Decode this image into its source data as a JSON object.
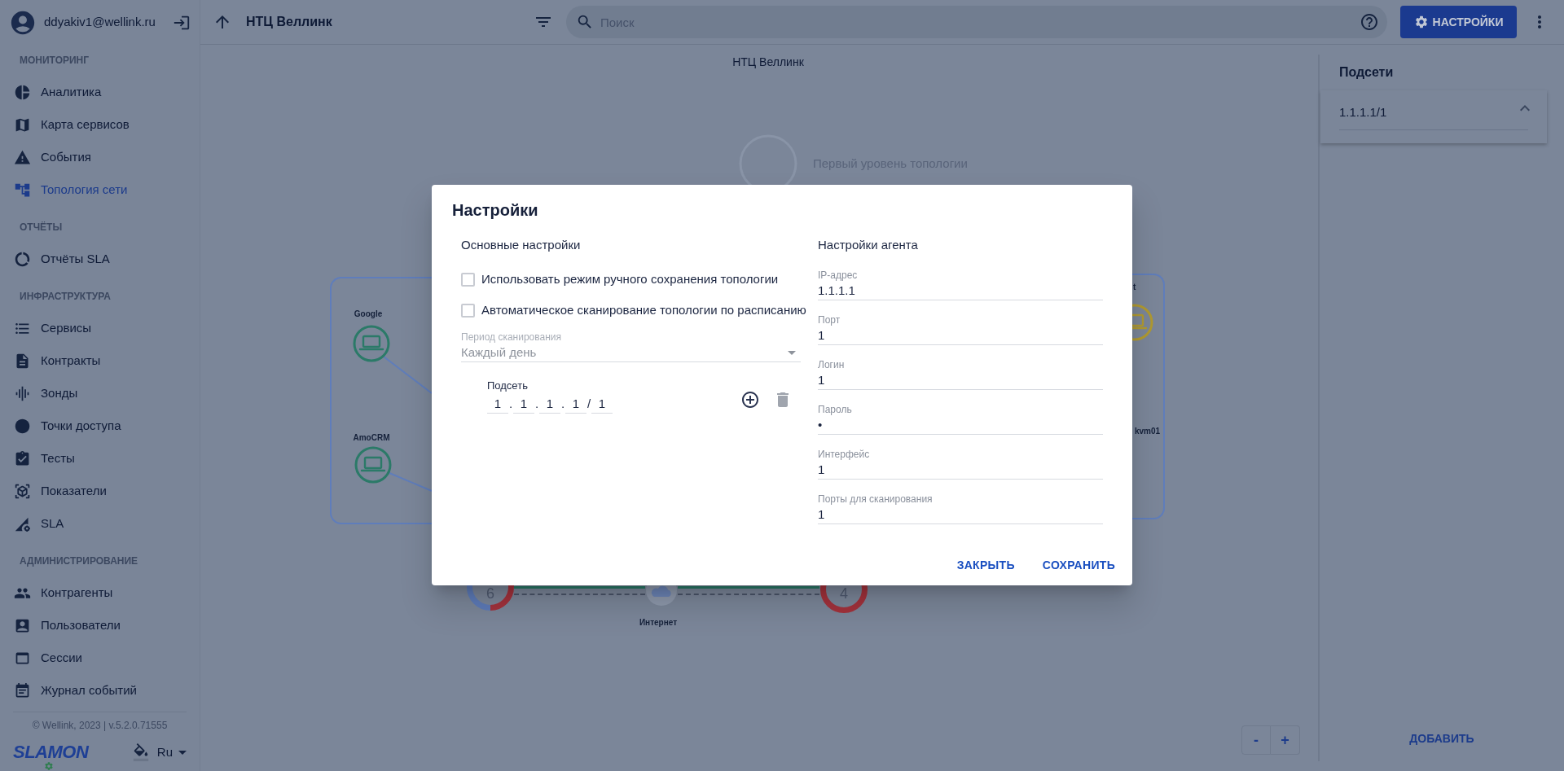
{
  "user": {
    "email": "ddyakiv1@wellink.ru"
  },
  "sidebar": {
    "sections": [
      {
        "title": "МОНИТОРИНГ",
        "items": [
          {
            "label": "Аналитика",
            "selected": false
          },
          {
            "label": "Карта сервисов",
            "selected": false
          },
          {
            "label": "События",
            "selected": false
          },
          {
            "label": "Топология сети",
            "selected": true
          }
        ]
      },
      {
        "title": "ОТЧЁТЫ",
        "items": [
          {
            "label": "Отчёты SLA",
            "selected": false
          }
        ]
      },
      {
        "title": "ИНФРАСТРУКТУРА",
        "items": [
          {
            "label": "Сервисы",
            "selected": false
          },
          {
            "label": "Контракты",
            "selected": false
          },
          {
            "label": "Зонды",
            "selected": false
          },
          {
            "label": "Точки доступа",
            "selected": false
          },
          {
            "label": "Тесты",
            "selected": false
          },
          {
            "label": "Показатели",
            "selected": false
          },
          {
            "label": "SLA",
            "selected": false
          }
        ]
      },
      {
        "title": "АДМИНИСТРИРОВАНИЕ",
        "items": [
          {
            "label": "Контрагенты",
            "selected": false
          },
          {
            "label": "Пользователи",
            "selected": false
          },
          {
            "label": "Сессии",
            "selected": false
          },
          {
            "label": "Журнал событий",
            "selected": false
          }
        ]
      }
    ],
    "footer": {
      "copyright": "© Wellink, 2023 | v.5.2.0.71555",
      "logo": "SLAMON",
      "language": "Ru"
    }
  },
  "toolbar": {
    "title": "НТЦ Веллинк",
    "search": {
      "placeholder": "Поиск"
    },
    "settings_button": "НАСТРОЙКИ"
  },
  "topology": {
    "title": "НТЦ Веллинк",
    "level_label": "Первый уровень топологии",
    "hosts": [
      {
        "label": "Google",
        "color": "#2b7a68"
      },
      {
        "label": "AmoCRM",
        "color": "#2b7a68"
      },
      {
        "label": "t",
        "color": "#b09a31"
      },
      {
        "label": "kvm01"
      }
    ],
    "counters": [
      {
        "value": "6",
        "segments": [
          {
            "color": "#5d7bb8"
          },
          {
            "color": "#a3323c"
          }
        ]
      },
      {
        "value": "4",
        "segments": [
          {
            "color": "#a3323c"
          }
        ]
      }
    ],
    "cloud": {
      "label": "Интернет"
    },
    "zoom": {
      "out": "-",
      "in": "+"
    }
  },
  "subnets": {
    "title": "Подсети",
    "items": [
      {
        "label": "1.1.1.1/1",
        "expanded": true
      }
    ],
    "add_button": "ДОБАВИТЬ"
  },
  "dialog": {
    "title": "Настройки",
    "general": {
      "title": "Основные настройки",
      "options": [
        {
          "label": "Использовать режим ручного сохранения топологии",
          "checked": false
        },
        {
          "label": "Автоматическое сканирование топологии по расписанию",
          "checked": false
        }
      ],
      "period": {
        "label": "Период сканирования",
        "value": "Каждый день",
        "disabled": true
      },
      "subnet": {
        "label": "Подсеть",
        "octets": [
          "1",
          "1",
          "1",
          "1",
          "1"
        ],
        "separators": [
          ".",
          ".",
          ".",
          "/"
        ],
        "remove_disabled": true
      }
    },
    "agent": {
      "title": "Настройки агента",
      "fields": [
        {
          "label": "IP-адрес",
          "value": "1.1.1.1"
        },
        {
          "label": "Порт",
          "value": "1"
        },
        {
          "label": "Логин",
          "value": "1"
        },
        {
          "label": "Пароль",
          "value": "•"
        },
        {
          "label": "Интерфейс",
          "value": "1"
        },
        {
          "label": "Порты для сканирования",
          "value": "1"
        }
      ]
    },
    "buttons": [
      "ЗАКРЫТЬ",
      "СОХРАНИТЬ"
    ]
  }
}
